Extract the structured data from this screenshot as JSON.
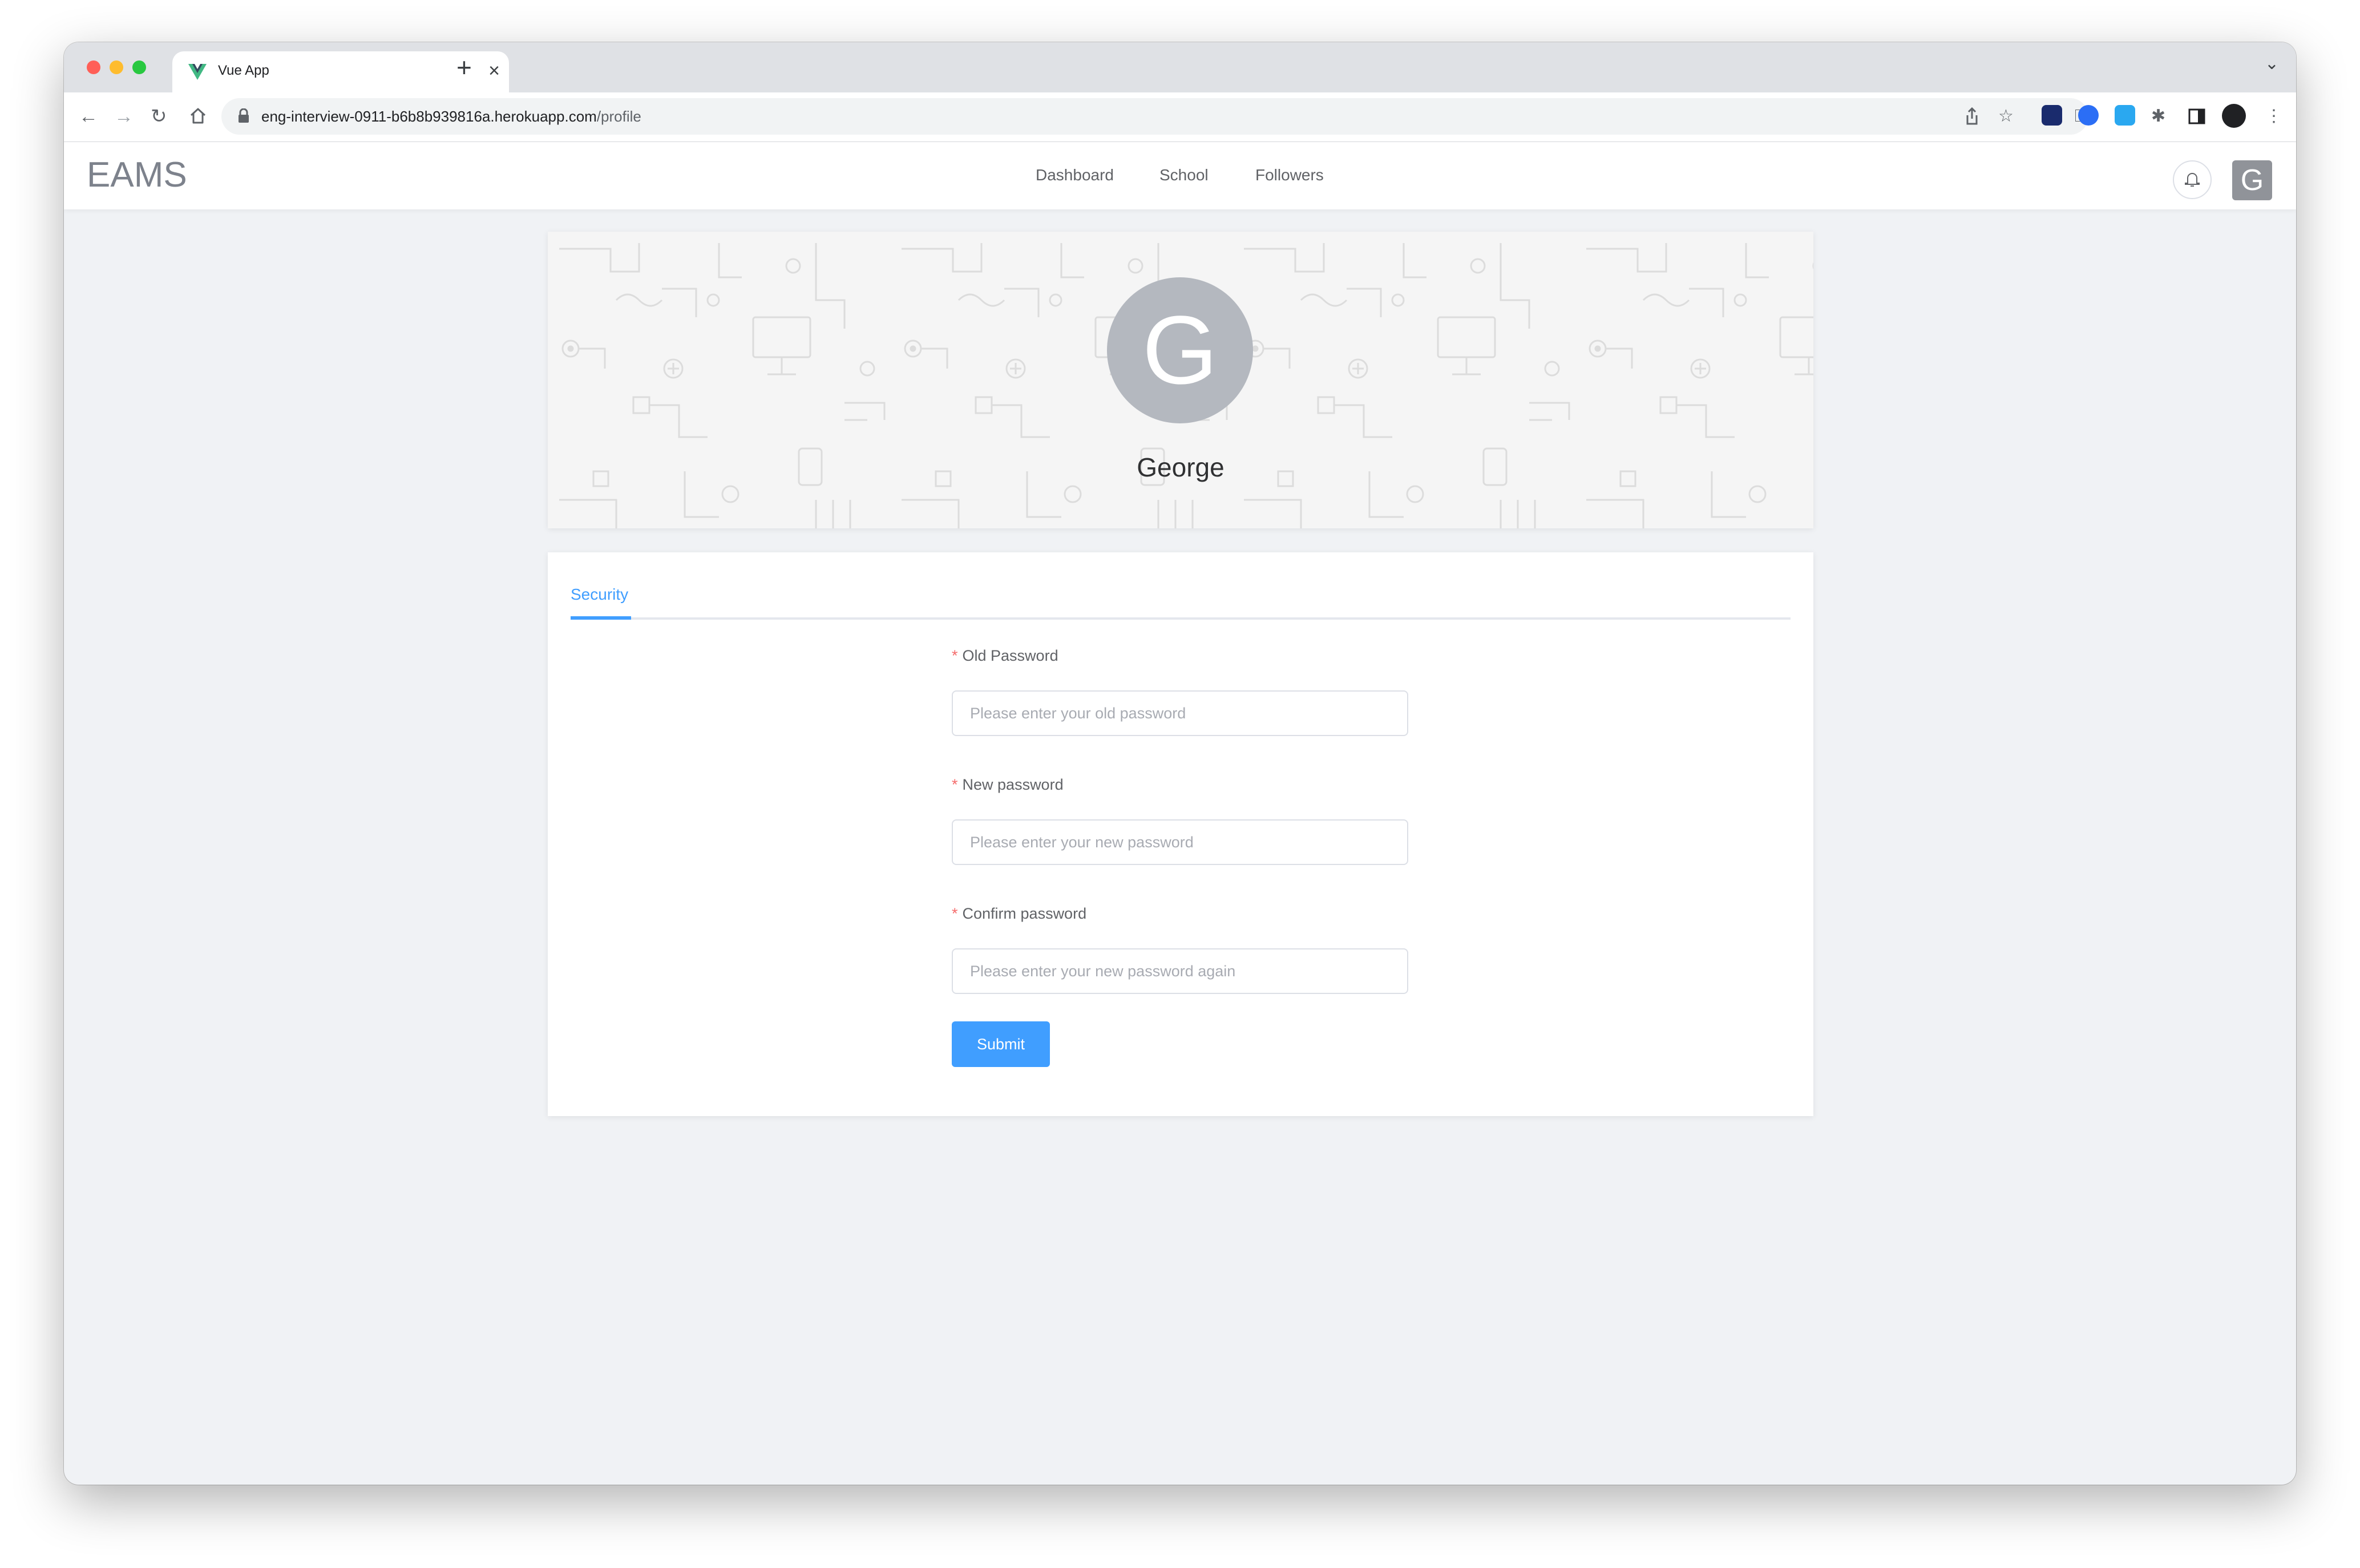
{
  "browser": {
    "tab_title": "Vue App",
    "url_host": "eng-interview-0911-b6b8b939816a.herokuapp.com",
    "url_path": "/profile",
    "icons": [
      "back-icon",
      "forward-icon",
      "reload-icon",
      "home-icon",
      "lock-icon",
      "key-icon",
      "share-icon",
      "star-icon",
      "extension-icon",
      "sidebar-icon",
      "profile-icon",
      "menu-icon"
    ]
  },
  "app": {
    "logo": "EAMS",
    "nav": [
      "Dashboard",
      "School",
      "Followers"
    ],
    "avatar_letter": "G"
  },
  "profile": {
    "avatar_letter": "G",
    "name": "George"
  },
  "security": {
    "tab": "Security",
    "fields": [
      {
        "label": "Old Password",
        "placeholder": "Please enter your old password",
        "required": true
      },
      {
        "label": "New password",
        "placeholder": "Please enter your new password",
        "required": true
      },
      {
        "label": "Confirm password",
        "placeholder": "Please enter your new password again",
        "required": true
      }
    ],
    "submit_label": "Submit"
  },
  "colors": {
    "accent": "#409eff",
    "required": "#f56c6c",
    "avatar": "#b4b8bf",
    "page_bg": "#f0f2f5"
  }
}
